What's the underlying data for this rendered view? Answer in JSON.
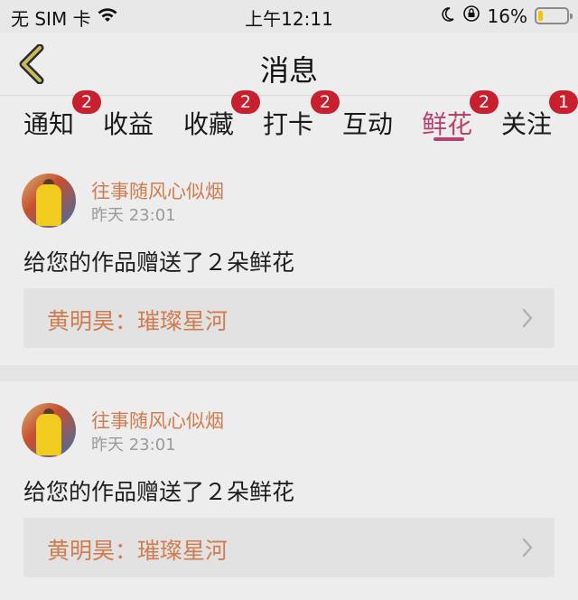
{
  "status_bar": {
    "carrier": "无 SIM 卡",
    "time": "上午12:11",
    "battery_text": "16%",
    "battery_level": 0.16,
    "icons": [
      "wifi-icon",
      "moon-icon",
      "orientation-lock-icon",
      "battery-icon"
    ]
  },
  "nav": {
    "title": "消息",
    "back_icon": "chevron-left-icon"
  },
  "tabs": [
    {
      "label": "通知",
      "badge": "2"
    },
    {
      "label": "收益"
    },
    {
      "label": "收藏",
      "badge": "2"
    },
    {
      "label": "打卡",
      "badge": "2"
    },
    {
      "label": "互动"
    },
    {
      "label": "鲜花",
      "badge": "2",
      "active": true
    },
    {
      "label": "关注",
      "badge": "1"
    }
  ],
  "messages": [
    {
      "sender": "往事随风心似烟",
      "time": "昨天 23:01",
      "text": "给您的作品赠送了２朵鲜花",
      "work": "黄明昊：璀璨星河"
    },
    {
      "sender": "往事随风心似烟",
      "time": "昨天 23:01",
      "text": "给您的作品赠送了２朵鲜花",
      "work": "黄明昊：璀璨星河"
    }
  ],
  "colors": {
    "accent": "#b7406c",
    "badge": "#c8202f",
    "username": "#cf7c4e",
    "battery": "#f5c400"
  }
}
